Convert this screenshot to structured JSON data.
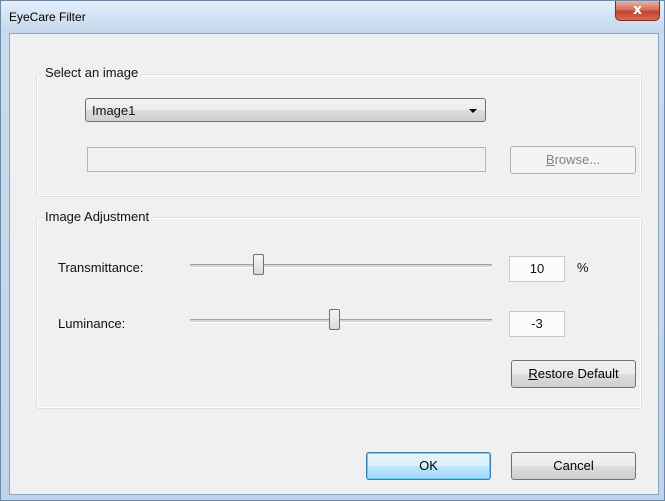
{
  "window": {
    "title": "EyeCare Filter",
    "close_glyph": "x"
  },
  "select_group": {
    "title": "Select an image",
    "image_select": {
      "value": "Image1"
    },
    "path_value": "",
    "browse": {
      "accel": "B",
      "rest": "rowse..."
    }
  },
  "adjust_group": {
    "title": "Image Adjustment",
    "transmittance": {
      "label": "Transmittance:",
      "value": "10",
      "unit": "%",
      "level": 0.23
    },
    "luminance": {
      "label": "Luminance:",
      "value": "-3",
      "level": 0.48
    },
    "restore": {
      "accel": "R",
      "rest": "estore Default"
    }
  },
  "footer": {
    "ok_label": "OK",
    "cancel_label": "Cancel"
  },
  "colors": {
    "close_button": "#c0432d",
    "default_button_border": "#3c7fb1"
  },
  "icons": {
    "close": "close-icon",
    "dropdown": "chevron-down-icon"
  }
}
